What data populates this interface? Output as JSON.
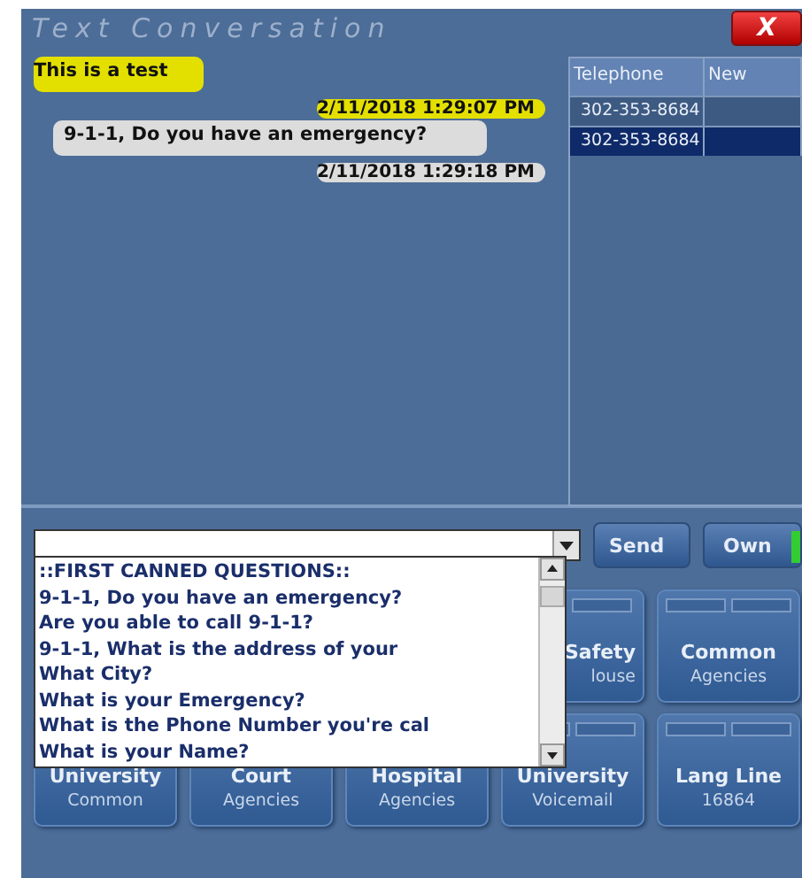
{
  "window": {
    "title": "Text Conversation",
    "close": "X"
  },
  "messages": [
    {
      "kind": "incoming",
      "text": "This is a test",
      "time": "2/11/2018 1:29:07 PM"
    },
    {
      "kind": "outgoing",
      "text": "9-1-1, Do you have an emergency?",
      "time": "2/11/2018 1:29:18 PM"
    }
  ],
  "table": {
    "columns": [
      "Telephone",
      "New"
    ],
    "rows": [
      {
        "telephone": "302-353-8684",
        "selected": false
      },
      {
        "telephone": "302-353-8684",
        "selected": true
      }
    ]
  },
  "dropdown": {
    "items": [
      "::FIRST CANNED QUESTIONS::",
      "9-1-1, Do you have an emergency?",
      "Are you able to call 9-1-1?",
      "9-1-1, What is the address of your",
      "What City?",
      "What is your Emergency?",
      "What is the Phone Number you're cal",
      "What is your Name?"
    ]
  },
  "buttons": [
    {
      "label": "Send",
      "indicator": false
    },
    {
      "label": "Own",
      "indicator": true
    }
  ],
  "tile_rows": [
    [
      {
        "kind": "partial",
        "title": "Safety",
        "subtitle": "louse"
      },
      {
        "kind": "full",
        "title": "Common",
        "subtitle": "Agencies"
      }
    ],
    [
      {
        "kind": "full",
        "title": "University",
        "subtitle": "Common"
      },
      {
        "kind": "full",
        "title": "Court",
        "subtitle": "Agencies"
      },
      {
        "kind": "full",
        "title": "Hospital",
        "subtitle": "Agencies"
      },
      {
        "kind": "full",
        "title": "University",
        "subtitle": "Voicemail"
      },
      {
        "kind": "full",
        "title": "Lang Line",
        "subtitle": "16864"
      }
    ]
  ]
}
